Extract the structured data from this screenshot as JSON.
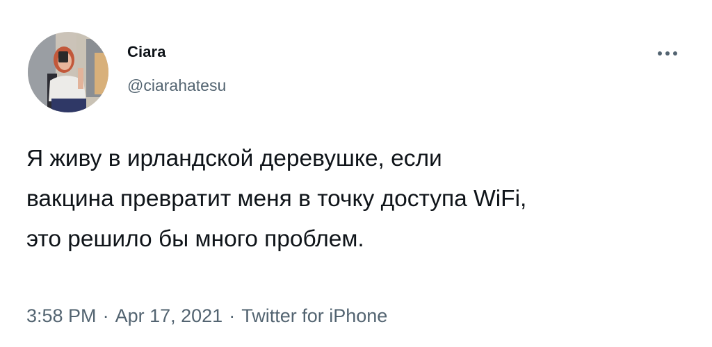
{
  "tweet": {
    "author": {
      "name": "Ciara",
      "handle": "@ciarahatesu",
      "avatar_icon": "user-avatar-photo"
    },
    "more_icon": "ellipsis-icon",
    "text": "Я живу в ирландской деревушке, если\nвакцина превратит меня в точку доступа WiFi,\nэто решило бы много проблем.",
    "meta": {
      "time": "3:58 PM",
      "separator": "·",
      "date": "Apr 17, 2021",
      "source": "Twitter for iPhone"
    },
    "colors": {
      "text": "#0f1419",
      "secondary": "#536471",
      "background": "#ffffff"
    }
  }
}
